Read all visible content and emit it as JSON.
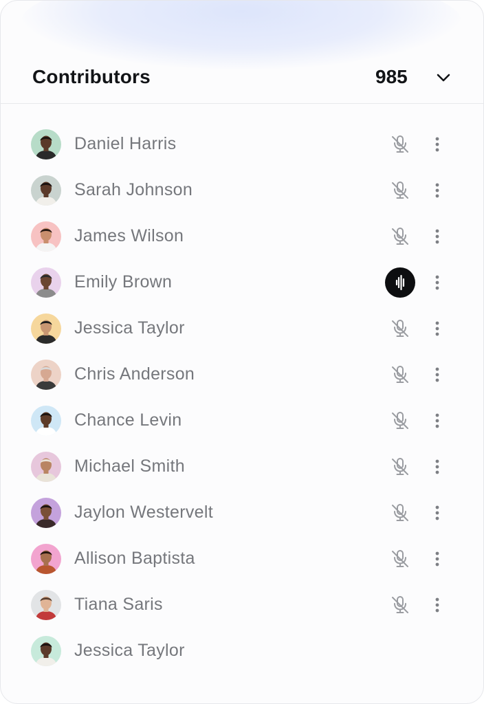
{
  "header": {
    "title": "Contributors",
    "count": "985",
    "toggle_icon": "chevron-down-icon"
  },
  "colors": {
    "title": "#121417",
    "name": "#75777c",
    "icon": "#9a9ca1",
    "speaking_bg": "#0d0e10"
  },
  "contributors": [
    {
      "name": "Daniel Harris",
      "mic": "muted",
      "bg": "#b7dcc8",
      "skin": "#5a3a28",
      "hair": "#1c1410",
      "shirt": "#2a2a2a"
    },
    {
      "name": "Sarah Johnson",
      "mic": "muted",
      "bg": "#c9d3cf",
      "skin": "#5b3a2a",
      "hair": "#1a1210",
      "shirt": "#f1efea"
    },
    {
      "name": "James Wilson",
      "mic": "muted",
      "bg": "#f7c2c2",
      "skin": "#c98f6e",
      "hair": "#2a1b14",
      "shirt": "#f4f4f4"
    },
    {
      "name": "Emily Brown",
      "mic": "speaking",
      "bg": "#e9d2ec",
      "skin": "#6b4532",
      "hair": "#2b2b2b",
      "shirt": "#8c8c8c"
    },
    {
      "name": "Jessica Taylor",
      "mic": "muted",
      "bg": "#f6d79c",
      "skin": "#c89672",
      "hair": "#1d1d1d",
      "shirt": "#2b2b2b"
    },
    {
      "name": "Chris Anderson",
      "mic": "muted",
      "bg": "#edd3c7",
      "skin": "#d6a892",
      "hair": "#d9d9d9",
      "shirt": "#3a3a3a"
    },
    {
      "name": "Chance Levin",
      "mic": "muted",
      "bg": "#cfe7f6",
      "skin": "#5d3b28",
      "hair": "#1b1310",
      "shirt": "#ffffff"
    },
    {
      "name": "Michael Smith",
      "mic": "muted",
      "bg": "#e7c7dc",
      "skin": "#b98563",
      "hair": "#e9e3d8",
      "shirt": "#e9e3d8"
    },
    {
      "name": "Jaylon Westervelt",
      "mic": "muted",
      "bg": "#c4a2dc",
      "skin": "#7a4f37",
      "hair": "#1b1310",
      "shirt": "#3a2a2a"
    },
    {
      "name": "Allison Baptista",
      "mic": "muted",
      "bg": "#f2a4cf",
      "skin": "#a8704f",
      "hair": "#24160f",
      "shirt": "#b8562f"
    },
    {
      "name": "Tiana Saris",
      "mic": "muted",
      "bg": "#e2e4e6",
      "skin": "#e0b496",
      "hair": "#5a4030",
      "shirt": "#c23a3a"
    },
    {
      "name": "Jessica Taylor",
      "mic": "none",
      "bg": "#c7eadb",
      "skin": "#5b3a2a",
      "hair": "#1a1210",
      "shirt": "#f1efea"
    }
  ],
  "icons": {
    "muted": "mic-off-icon",
    "speaking": "audio-wave-icon",
    "more": "more-vertical-icon"
  }
}
